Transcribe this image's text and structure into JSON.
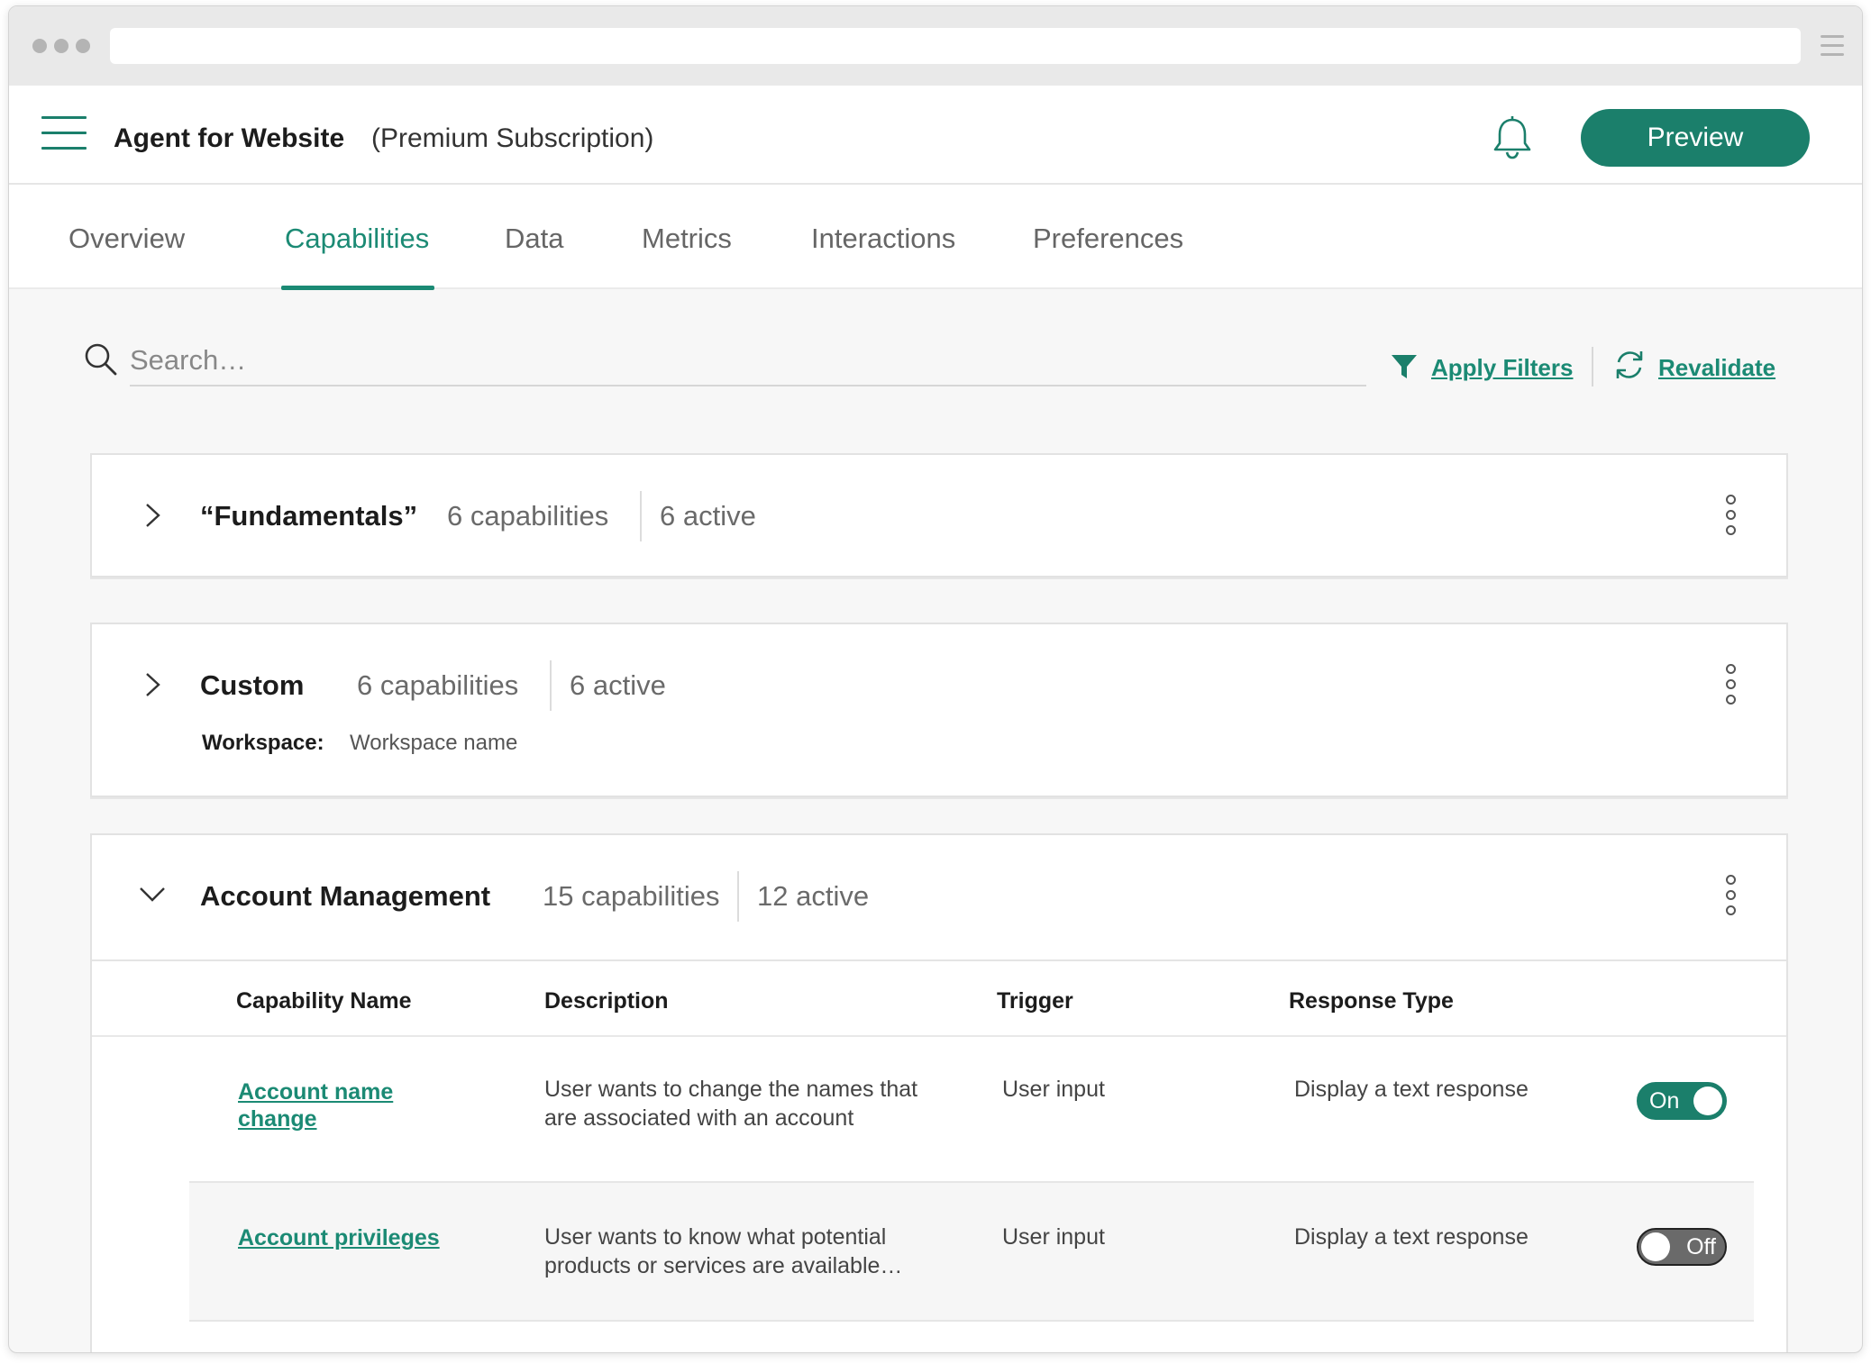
{
  "app": {
    "title": "Agent for Website",
    "subtitle": "(Premium Subscription)",
    "preview_label": "Preview"
  },
  "tabs": [
    {
      "label": "Overview"
    },
    {
      "label": "Capabilities"
    },
    {
      "label": "Data"
    },
    {
      "label": "Metrics"
    },
    {
      "label": "Interactions"
    },
    {
      "label": "Preferences"
    }
  ],
  "active_tab": "Capabilities",
  "search": {
    "placeholder": "Search…",
    "value": ""
  },
  "toolbar": {
    "apply_filters": "Apply Filters",
    "revalidate": "Revalidate"
  },
  "groups": [
    {
      "title": "“Fundamentals”",
      "capabilities": "6 capabilities",
      "active": "6 active",
      "expanded": false
    },
    {
      "title": "Custom",
      "capabilities": "6 capabilities",
      "active": "6 active",
      "workspace_label": "Workspace:",
      "workspace_value": "Workspace name",
      "expanded": false
    },
    {
      "title": "Account Management",
      "capabilities": "15 capabilities",
      "active": "12 active",
      "expanded": true
    }
  ],
  "table": {
    "columns": [
      "Capability Name",
      "Description",
      "Trigger",
      "Response Type"
    ],
    "rows": [
      {
        "name": "Account name change",
        "description": "User wants to change the names that are associated with an account",
        "trigger": "User input",
        "response": "Display a text response",
        "toggle": "On"
      },
      {
        "name": "Account privileges",
        "description": "User wants to know what potential products or services are available…",
        "trigger": "User input",
        "response": "Display a text response",
        "toggle": "Off"
      }
    ]
  },
  "colors": {
    "accent": "#1b7f6b",
    "link": "#1b8a74",
    "toggle_off": "#6a6a6a"
  },
  "icons": [
    "hamburger-icon",
    "bell-icon",
    "search-icon",
    "filter-icon",
    "refresh-icon",
    "chevron-right-icon",
    "chevron-down-icon",
    "kebab-icon"
  ]
}
